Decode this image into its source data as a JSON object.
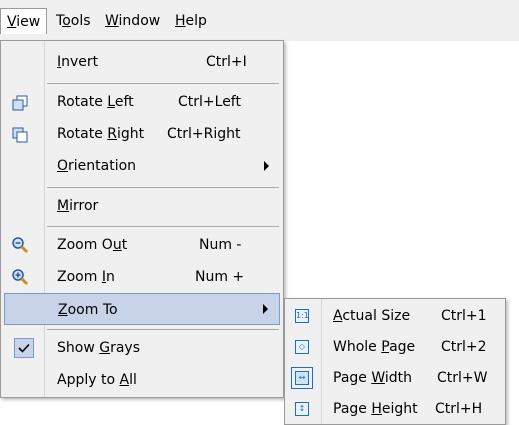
{
  "menubar": {
    "items": [
      {
        "label": "View",
        "active": true
      },
      {
        "label": "Tools"
      },
      {
        "label": "Window"
      },
      {
        "label": "Help"
      }
    ]
  },
  "view_menu": {
    "items": [
      {
        "label": "Invert",
        "shortcut": "Ctrl+I",
        "icon": null
      },
      {
        "label": "Rotate Left",
        "shortcut": "Ctrl+Left",
        "icon": "rotate-left-icon"
      },
      {
        "label": "Rotate Right",
        "shortcut": "Ctrl+Right",
        "icon": "rotate-right-icon"
      },
      {
        "label": "Orientation",
        "submenu": true
      },
      {
        "label": "Mirror"
      },
      {
        "label": "Zoom Out",
        "shortcut": "Num -",
        "icon": "zoom-out-icon"
      },
      {
        "label": "Zoom In",
        "shortcut": "Num +",
        "icon": "zoom-in-icon"
      },
      {
        "label": "Zoom To",
        "submenu": true,
        "highlighted": true
      },
      {
        "label": "Show Grays",
        "checked": true
      },
      {
        "label": "Apply to All"
      }
    ]
  },
  "zoom_to_menu": {
    "items": [
      {
        "label": "Actual Size",
        "shortcut": "Ctrl+1",
        "icon_glyph": "1:1"
      },
      {
        "label": "Whole Page",
        "shortcut": "Ctrl+2",
        "icon_glyph": "◇"
      },
      {
        "label": "Page Width",
        "shortcut": "Ctrl+W",
        "icon_glyph": "↔",
        "selected": true
      },
      {
        "label": "Page Height",
        "shortcut": "Ctrl+H",
        "icon_glyph": "↕"
      }
    ]
  },
  "colors": {
    "highlight_bg": "#c7d3e6",
    "highlight_border": "#7c9ac4",
    "menu_bg": "#f0f0f0",
    "icon_blue": "#1d6fc4"
  }
}
